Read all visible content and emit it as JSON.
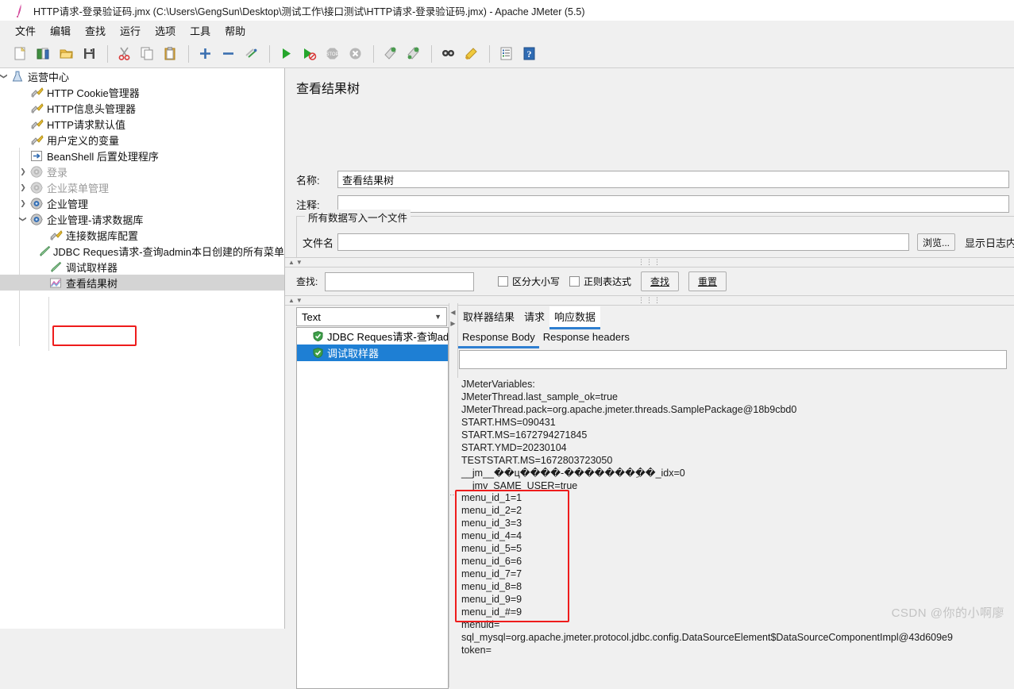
{
  "window": {
    "title": "HTTP请求-登录验证码.jmx (C:\\Users\\GengSun\\Desktop\\测试工作\\接口测试\\HTTP请求-登录验证码.jmx) - Apache JMeter (5.5)",
    "app_icon": "jmeter-feather-icon"
  },
  "menubar": {
    "items": [
      {
        "label": "文件",
        "name": "menu-file"
      },
      {
        "label": "编辑",
        "name": "menu-edit"
      },
      {
        "label": "查找",
        "name": "menu-search"
      },
      {
        "label": "运行",
        "name": "menu-run"
      },
      {
        "label": "选项",
        "name": "menu-options"
      },
      {
        "label": "工具",
        "name": "menu-tools"
      },
      {
        "label": "帮助",
        "name": "menu-help"
      }
    ]
  },
  "toolbar": {
    "buttons": [
      {
        "name": "new-icon",
        "tip": "新建"
      },
      {
        "name": "templates-icon",
        "tip": "模板"
      },
      {
        "name": "open-icon",
        "tip": "打开"
      },
      {
        "name": "save-icon",
        "tip": "保存"
      },
      {
        "name": "cut-icon",
        "tip": "剪切"
      },
      {
        "name": "copy-icon",
        "tip": "复制"
      },
      {
        "name": "paste-icon",
        "tip": "粘贴"
      },
      {
        "name": "expand-all-icon",
        "tip": "展开全部"
      },
      {
        "name": "collapse-all-icon",
        "tip": "收起全部"
      },
      {
        "name": "toggle-icon",
        "tip": "切换"
      },
      {
        "name": "start-icon",
        "tip": "启动"
      },
      {
        "name": "start-no-pauses-icon",
        "tip": "无间隔启动"
      },
      {
        "name": "stop-icon",
        "tip": "停止"
      },
      {
        "name": "shutdown-icon",
        "tip": "关闭"
      },
      {
        "name": "clear-icon",
        "tip": "清除"
      },
      {
        "name": "clear-all-icon",
        "tip": "清除全部"
      },
      {
        "name": "search-icon",
        "tip": "搜索"
      },
      {
        "name": "reset-search-icon",
        "tip": "重置搜索"
      },
      {
        "name": "function-helper-icon",
        "tip": "函数助手对话框"
      },
      {
        "name": "help-icon",
        "tip": "帮助"
      }
    ]
  },
  "tree": {
    "nodes": [
      {
        "label": "运营中心",
        "indent": 0,
        "twisty": "down",
        "icon": "test-plan-icon",
        "disabled": false,
        "selected": false
      },
      {
        "label": "HTTP Cookie管理器",
        "indent": 1,
        "twisty": "",
        "icon": "config-element-icon",
        "disabled": false,
        "selected": false
      },
      {
        "label": "HTTP信息头管理器",
        "indent": 1,
        "twisty": "",
        "icon": "config-element-icon",
        "disabled": false,
        "selected": false
      },
      {
        "label": "HTTP请求默认值",
        "indent": 1,
        "twisty": "",
        "icon": "config-element-icon",
        "disabled": false,
        "selected": false
      },
      {
        "label": "用户定义的变量",
        "indent": 1,
        "twisty": "",
        "icon": "config-element-icon",
        "disabled": false,
        "selected": false
      },
      {
        "label": "BeanShell 后置处理程序",
        "indent": 1,
        "twisty": "",
        "icon": "post-processor-icon",
        "disabled": false,
        "selected": false
      },
      {
        "label": "登录",
        "indent": 1,
        "twisty": "right",
        "icon": "thread-group-disabled-icon",
        "disabled": true,
        "selected": false
      },
      {
        "label": "企业菜单管理",
        "indent": 1,
        "twisty": "right",
        "icon": "thread-group-disabled-icon",
        "disabled": true,
        "selected": false
      },
      {
        "label": "企业管理",
        "indent": 1,
        "twisty": "right",
        "icon": "thread-group-icon",
        "disabled": false,
        "selected": false
      },
      {
        "label": "企业管理-请求数据库",
        "indent": 1,
        "twisty": "down",
        "icon": "thread-group-icon",
        "disabled": false,
        "selected": false
      },
      {
        "label": "连接数据库配置",
        "indent": 2,
        "twisty": "",
        "icon": "config-element-icon",
        "disabled": false,
        "selected": false
      },
      {
        "label": "JDBC Reques请求-查询admin本日创建的所有菜单",
        "indent": 2,
        "twisty": "",
        "icon": "sampler-icon",
        "disabled": false,
        "selected": false
      },
      {
        "label": "调试取样器",
        "indent": 2,
        "twisty": "",
        "icon": "sampler-icon",
        "disabled": false,
        "selected": false
      },
      {
        "label": "查看结果树",
        "indent": 2,
        "twisty": "",
        "icon": "view-results-tree-icon",
        "disabled": false,
        "selected": true
      }
    ]
  },
  "panel": {
    "title": "查看结果树",
    "name_label": "名称:",
    "name_value": "查看结果树",
    "comment_label": "注释:",
    "comment_value": "",
    "group_title": "所有数据写入一个文件",
    "filename_label": "文件名",
    "filename_value": "",
    "browse_button": "浏览...",
    "log_display_label": "显示日志内容"
  },
  "search": {
    "label": "查找:",
    "value": "",
    "case_sensitive_label": "区分大小写",
    "regex_label": "正则表达式",
    "find_button": "查找",
    "reset_button": "重置"
  },
  "results": {
    "renderer_selected": "Text",
    "samplers": [
      {
        "label": "JDBC Reques请求-查询admin本日创建的所有菜单",
        "status": "success",
        "selected": false
      },
      {
        "label": "调试取样器",
        "status": "success",
        "selected": true
      }
    ],
    "tabs": [
      {
        "label": "取样器结果",
        "active": false
      },
      {
        "label": "请求",
        "active": false
      },
      {
        "label": "响应数据",
        "active": true
      }
    ],
    "subtabs": [
      {
        "label": "Response Body",
        "active": true
      },
      {
        "label": "Response headers",
        "active": false
      }
    ],
    "find_field_value": "",
    "response_body_before": [
      "JMeterVariables:",
      "JMeterThread.last_sample_ok=true",
      "JMeterThread.pack=org.apache.jmeter.threads.SamplePackage@18b9cbd0",
      "START.HMS=090431",
      "START.MS=1672794271845",
      "START.YMD=20230104",
      "TESTSTART.MS=1672803723050",
      "__jm__��ц����-��������ِ�_idx=0",
      "__jmv_SAME_USER=true"
    ],
    "response_body_highlighted": [
      "menu_id_1=1",
      "menu_id_2=2",
      "menu_id_3=3",
      "menu_id_4=4",
      "menu_id_5=5",
      "menu_id_6=6",
      "menu_id_7=7",
      "menu_id_8=8",
      "menu_id_9=9",
      "menu_id_#=9"
    ],
    "response_body_after": [
      "menuid=",
      "sql_mysql=org.apache.jmeter.protocol.jdbc.config.DataSourceElement$DataSourceComponentImpl@43d609e9",
      "token="
    ]
  },
  "annotations": {
    "highlight_color": "#ee1c1c"
  },
  "watermark": {
    "text": "CSDN @你的小啊廖"
  }
}
